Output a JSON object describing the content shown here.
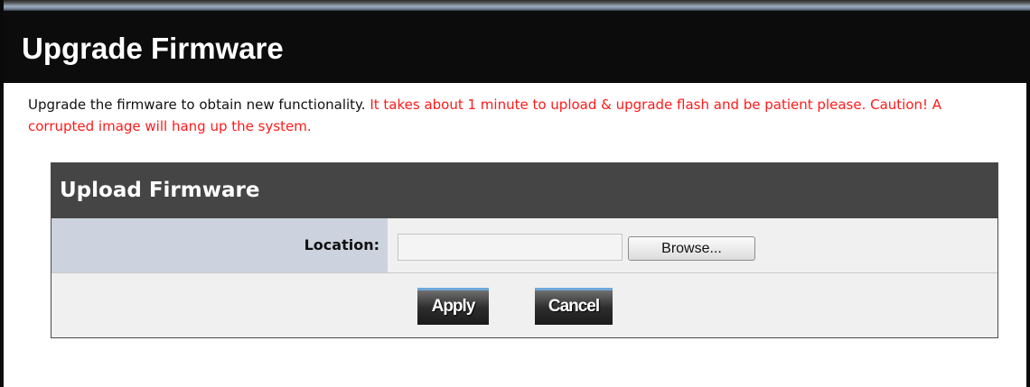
{
  "page": {
    "title": "Upgrade Firmware",
    "intro_text": "Upgrade the firmware to obtain new functionality.",
    "warning_text": "It takes about 1 minute to upload & upgrade flash and be patient please. Caution! A corrupted image will hang up the system."
  },
  "upload_panel": {
    "title": "Upload Firmware",
    "location_label": "Location:",
    "location_value": "",
    "browse_label": "Browse...",
    "apply_label": "Apply",
    "cancel_label": "Cancel"
  },
  "colors": {
    "title_bar": "#0c0c0c",
    "panel_header": "#454545",
    "label_cell": "#ccd3de",
    "panel_body": "#f0f0f0",
    "warning": "#ff1a1a"
  }
}
